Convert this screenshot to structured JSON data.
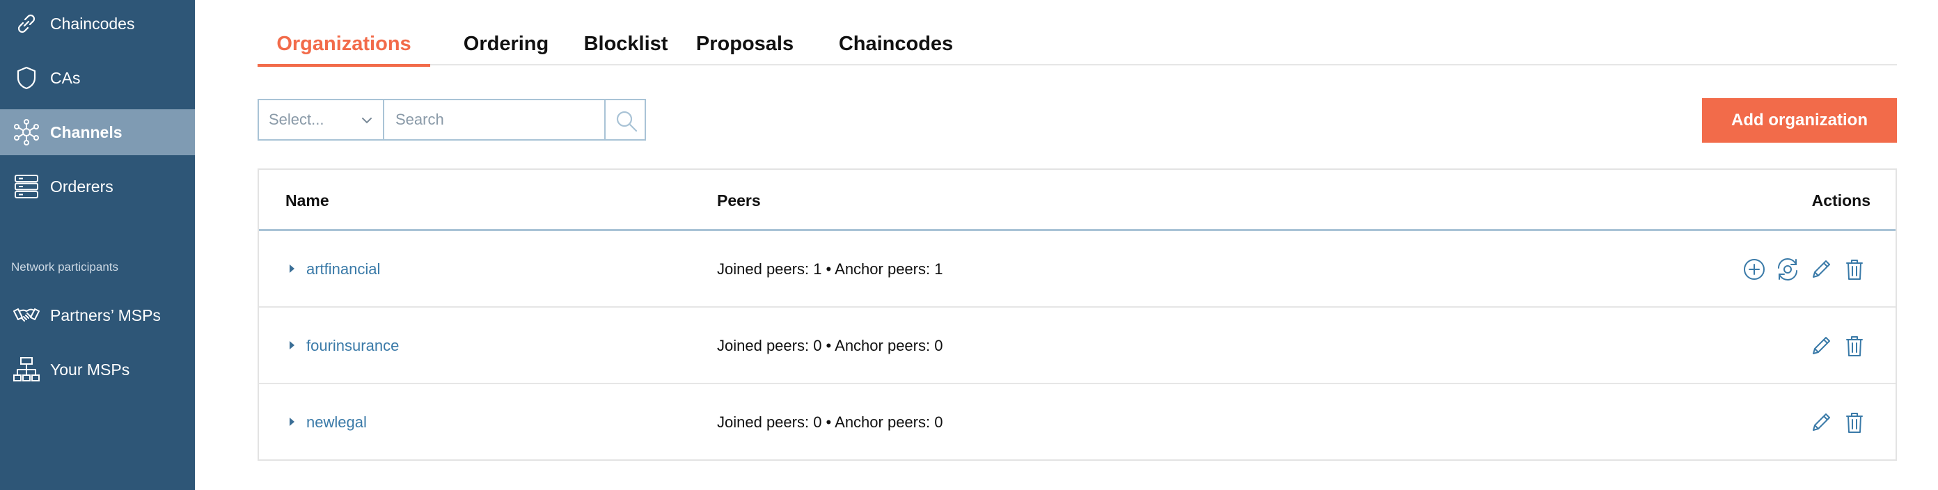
{
  "sidebar": {
    "items": [
      {
        "label": "Chaincodes",
        "icon": "link-icon"
      },
      {
        "label": "CAs",
        "icon": "shield-icon"
      },
      {
        "label": "Channels",
        "icon": "network-icon",
        "active": true
      },
      {
        "label": "Orderers",
        "icon": "server-icon"
      }
    ],
    "section_label": "Network participants",
    "participants": [
      {
        "label": "Partners’ MSPs",
        "icon": "handshake-icon"
      },
      {
        "label": "Your MSPs",
        "icon": "hierarchy-icon"
      }
    ]
  },
  "tabs": [
    {
      "label": "Organizations",
      "active": true
    },
    {
      "label": "Ordering"
    },
    {
      "label": "Blocklist"
    },
    {
      "label": "Proposals"
    },
    {
      "label": "Chaincodes"
    }
  ],
  "toolbar": {
    "select_placeholder": "Select...",
    "search_placeholder": "Search",
    "add_button": "Add organization"
  },
  "table": {
    "headers": {
      "name": "Name",
      "peers": "Peers",
      "actions": "Actions"
    },
    "rows": [
      {
        "name": "artfinancial",
        "peers": "Joined peers: 1 • Anchor peers: 1",
        "actions": [
          "add-peer-icon",
          "anchor-peer-icon",
          "edit-icon",
          "delete-icon"
        ]
      },
      {
        "name": "fourinsurance",
        "peers": "Joined peers: 0 • Anchor peers: 0",
        "actions": [
          "edit-icon",
          "delete-icon"
        ]
      },
      {
        "name": "newlegal",
        "peers": "Joined peers: 0 • Anchor peers: 0",
        "actions": [
          "edit-icon",
          "delete-icon"
        ]
      }
    ]
  },
  "colors": {
    "sidebar_bg": "#2e5677",
    "sidebar_active": "#7f9bb3",
    "accent": "#f26b4a",
    "link": "#3a7aa8",
    "border": "#a9c3d6"
  }
}
